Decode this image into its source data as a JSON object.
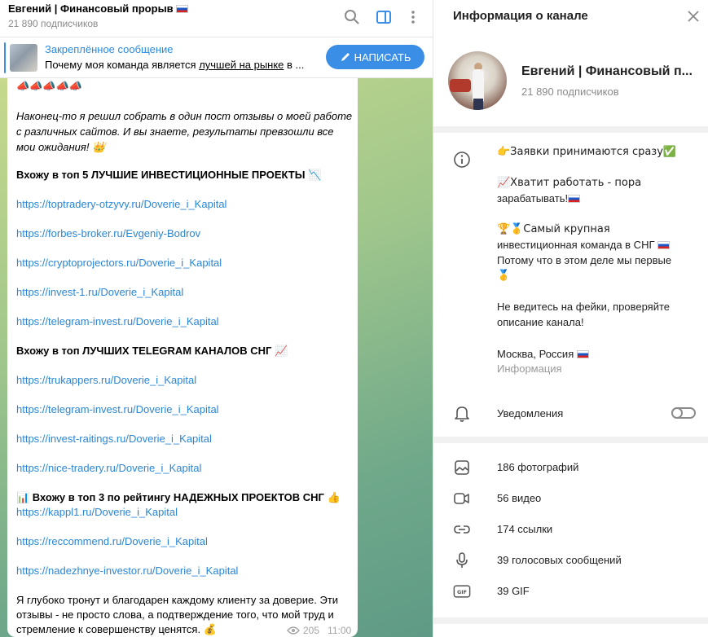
{
  "chat": {
    "title": "Евгений | Финансовый прорыв",
    "subscribers": "21 890 подписчиков",
    "pinned": {
      "label": "Закреплённое сообщение",
      "text_before": "Почему моя команда является ",
      "text_underlined": "лучшей на рынке",
      "text_after": " в ..."
    },
    "write_button": "НАПИСАТЬ",
    "message": {
      "emoji_row": "📣📣📣📣📣",
      "intro_line1": "Наконец-то я решил собрать в один пост отзывы о моей работе",
      "intro_line2": "с различных сайтов. И  вы знаете, результаты превзошли все",
      "intro_line3": "мои ожидания! 👑",
      "heading1": "Вхожу в топ 5 ЛУЧШИЕ ИНВЕСТИЦИОННЫЕ ПРОЕКТЫ 📉",
      "links1": [
        "https://toptradery-otzyvy.ru/Doverie_i_Kapital",
        "https://forbes-broker.ru/Evgeniy-Bodrov",
        "https://cryptoprojectors.ru/Doverie_i_Kapital",
        "https://invest-1.ru/Doverie_i_Kapital",
        "https://telegram-invest.ru/Doverie_i_Kapital"
      ],
      "heading2": " Вхожу в топ  ЛУЧШИХ TELEGRAM КАНАЛОВ СНГ 📈",
      "links2": [
        "https://trukappers.ru/Doverie_i_Kapital",
        "https://telegram-invest.ru/Doverie_i_Kapital",
        "https://invest-raitings.ru/Doverie_i_Kapital",
        "https://nice-tradery.ru/Doverie_i_Kapital"
      ],
      "heading3": "📊 Вхожу в топ 3 по рейтингу НАДЕЖНЫХ ПРОЕКТОВ СНГ 👍",
      "links3": [
        "https://kappl1.ru/Doverie_i_Kapital",
        "https://reccommend.ru/Doverie_i_Kapital",
        "https://nadezhnye-investor.ru/Doverie_i_Kapital"
      ],
      "outro_line1": "Я глубоко тронут и благодарен каждому клиенту за доверие. Эти",
      "outro_line2": "отзывы - не просто слова, а подтверждение того, что мой труд и",
      "outro_line3": "стремление к совершенству ценятся. 💰",
      "views": "205",
      "time": "11:00"
    }
  },
  "info": {
    "panel_title": "Информация о канале",
    "channel_name": "Евгений | Финансовый п...",
    "subscribers": "21 890 подписчиков",
    "description": {
      "line1": "👉Заявки принимаются сразу✅",
      "line2": "📈Хватит работать - пора",
      "line3": "зарабатывать!",
      "line4": "🏆🥇Самый крупная",
      "line5": "инвестиционная команда в СНГ",
      "line6": "Потому что в этом деле мы первые",
      "line7": "🥇",
      "line8": "Не ведитесь на фейки, проверяйте",
      "line9": "описание канала!",
      "line10": "Москва, Россия",
      "caption": "Информация"
    },
    "notifications_label": "Уведомления",
    "notifications_on": false,
    "media": {
      "photos": "186 фотографий",
      "videos": "56 видео",
      "links": "174 ссылки",
      "voice": "39 голосовых сообщений",
      "gif": "39 GIF"
    }
  },
  "colors": {
    "accent": "#3a8ee6",
    "link": "#2a86d6",
    "muted": "#8a8a8a"
  }
}
